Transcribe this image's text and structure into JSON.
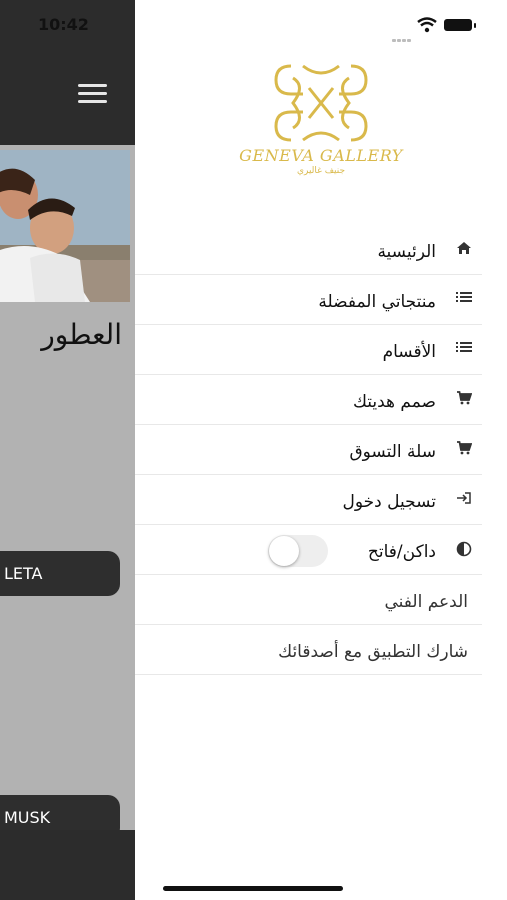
{
  "status_bar": {
    "time": "10:42"
  },
  "background_screen": {
    "section_title": "العطور",
    "pill_1": "LETA",
    "pill_2": "MUSK"
  },
  "logo": {
    "name": "GENEVA GALLERY",
    "arabic": "جنيف غاليري"
  },
  "menu": {
    "home": "الرئيسية",
    "favorites": "منتجاتي المفضلة",
    "categories": "الأقسام",
    "design_gift": "صمم هديتك",
    "cart": "سلة التسوق",
    "login": "تسجيل دخول",
    "theme_toggle": "داكن/فاتح",
    "support": "الدعم الفني",
    "share": "شارك التطبيق مع أصدقائك"
  },
  "colors": {
    "gold": "#d9b94b",
    "dark": "#2c2c2c"
  }
}
